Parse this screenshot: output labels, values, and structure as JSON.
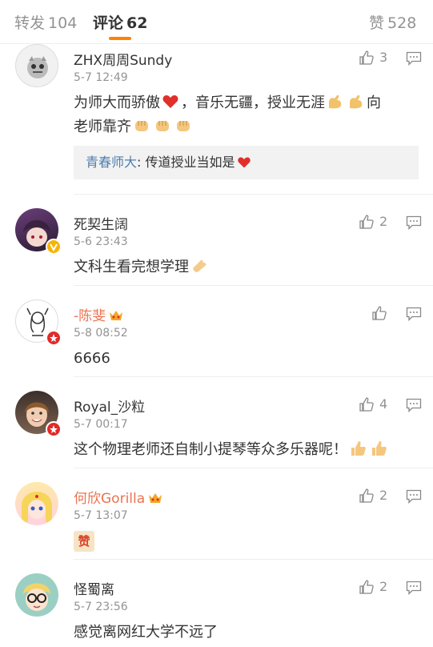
{
  "tabs": [
    {
      "label": "转发",
      "count": "104",
      "active": false
    },
    {
      "label": "评论",
      "count": "62",
      "active": true
    },
    {
      "label": "赞",
      "count": "528",
      "active": false
    }
  ],
  "comments": [
    {
      "name": "ZHX周周Sundy",
      "time": "5-7 12:49",
      "text_parts": [
        "为师大而骄傲",
        "，音乐无疆，授业无涯",
        "向",
        "老师靠齐"
      ],
      "likes": "3",
      "reply": {
        "name": "青春师大",
        "text": ": 传道授业当如是"
      }
    },
    {
      "name": "死契生阔",
      "time": "5-6 23:43",
      "text": "文科生看完想学理",
      "likes": "2"
    },
    {
      "name": "-陈斐",
      "time": "5-8 08:52",
      "text": "6666",
      "likes": ""
    },
    {
      "name": "Royal_沙粒",
      "time": "5-7 00:17",
      "text": "这个物理老师还自制小提琴等众多乐器呢！",
      "likes": "4"
    },
    {
      "name": "何欣Gorilla",
      "time": "5-7 13:07",
      "text": "",
      "likes": "2",
      "sticker": "赞"
    },
    {
      "name": "怪蜀离",
      "time": "5-7 23:56",
      "text": "感觉离网红大学不远了",
      "likes": "2"
    }
  ],
  "icons": {
    "like": "thumbs-up-icon",
    "reply": "comment-icon",
    "heart": "heart-icon",
    "muscle": "flexed-arm-icon",
    "fist": "fist-icon",
    "clap": "clap-icon",
    "thumb": "thumbs-up-emoji",
    "crown": "crown-icon"
  },
  "colors": {
    "accent": "#ff8200",
    "link": "#507daf",
    "vip": "#eb7350",
    "muted": "#939393"
  }
}
